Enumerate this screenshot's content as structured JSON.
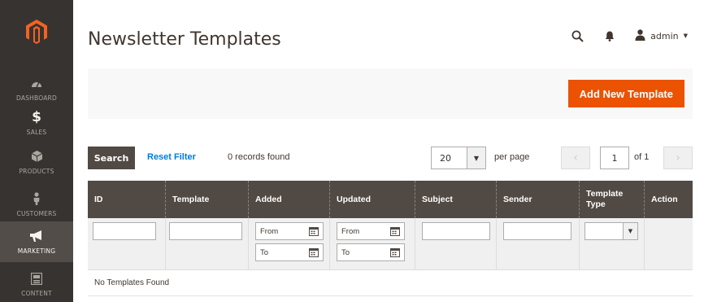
{
  "sidebar": {
    "items": [
      {
        "label": "Dashboard",
        "icon": "dashboard-icon"
      },
      {
        "label": "Sales",
        "icon": "dollar-icon"
      },
      {
        "label": "Products",
        "icon": "cube-icon"
      },
      {
        "label": "Customers",
        "icon": "person-icon"
      },
      {
        "label": "Marketing",
        "icon": "megaphone-icon",
        "active": true
      },
      {
        "label": "Content",
        "icon": "content-icon"
      }
    ]
  },
  "header": {
    "title": "Newsletter Templates",
    "user": "admin"
  },
  "actions": {
    "add_label": "Add New Template"
  },
  "toolbar": {
    "search_label": "Search",
    "reset_label": "Reset Filter",
    "records_found": "0 records found",
    "per_page_value": "20",
    "per_page_label": "per page",
    "current_page": "1",
    "page_of": "of 1"
  },
  "grid": {
    "columns": [
      "ID",
      "Template",
      "Added",
      "Updated",
      "Subject",
      "Sender",
      "Template Type",
      "Action"
    ],
    "filters": {
      "from_label": "From",
      "to_label": "To"
    },
    "empty_message": "No Templates Found"
  },
  "colors": {
    "sidebar_bg": "#373330",
    "brand_orange": "#eb5202",
    "grid_header_bg": "#514943",
    "link_blue": "#007bdb"
  }
}
